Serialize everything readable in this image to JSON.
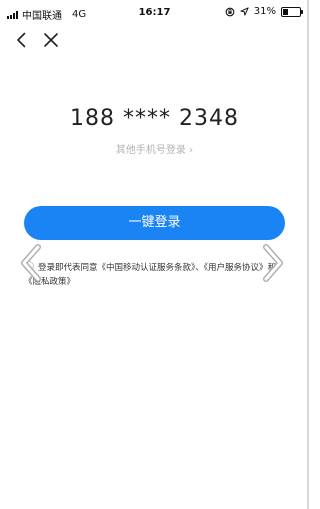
{
  "status_bar": {
    "carrier": "中国联通",
    "network": "4G",
    "time": "16:17",
    "battery_percent": "31%",
    "battery_level": 0.31
  },
  "nav": {
    "back_icon": "chevron-left-icon",
    "close_icon": "close-icon"
  },
  "login": {
    "phone_masked": "188 **** 2348",
    "other_phone_link": "其他手机号登录 ›",
    "primary_button": "一键登录",
    "agreement_prefix": "登录即代表同意",
    "agreement_link_1": "《中国移动认证服务条款》",
    "agreement_sep": "、",
    "agreement_link_2": "《用户服务协议》",
    "agreement_and": "和",
    "agreement_link_3": "《隐私政策》"
  },
  "colors": {
    "accent": "#1a84f5",
    "muted_text": "#b3b3b3"
  }
}
